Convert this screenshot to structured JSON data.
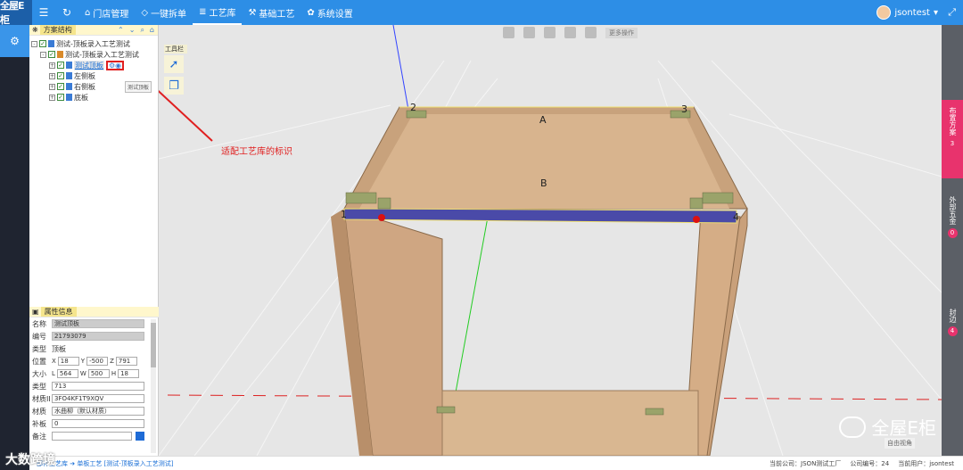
{
  "app": {
    "logo_text": "全屋E柜"
  },
  "topbar": {
    "menu_icon": "menu-icon",
    "refresh_icon": "refresh-icon",
    "nav": [
      {
        "label": "门店管理",
        "icon": "home-icon"
      },
      {
        "label": "一键拆单",
        "icon": "shield-icon"
      },
      {
        "label": "工艺库",
        "icon": "library-icon",
        "active": true
      },
      {
        "label": "基础工艺",
        "icon": "hammer-icon"
      },
      {
        "label": "系统设置",
        "icon": "gear-icon"
      }
    ],
    "username": "jsontest",
    "accent": "#2d8ee6"
  },
  "panel": {
    "header": "方案结构",
    "tree": [
      {
        "level": 0,
        "label": "测试-顶板录入工艺测试"
      },
      {
        "level": 1,
        "label": "测试-顶板录入工艺测试"
      },
      {
        "level": 2,
        "label": "测试顶板",
        "selected": true
      },
      {
        "level": 2,
        "label": "左侧板"
      },
      {
        "level": 2,
        "label": "右侧板"
      },
      {
        "level": 2,
        "label": "底板"
      }
    ],
    "tooltip": "测试顶板",
    "attr_header": "属性信息",
    "attrs": {
      "name_label": "名称",
      "name": "测试顶板",
      "code_label": "编号",
      "code": "21793079",
      "type_label": "类型",
      "type": "顶板",
      "pos_label": "位置",
      "x": "18",
      "y": "-500",
      "z": "791",
      "size_label": "大小",
      "l": "564",
      "w": "500",
      "h": "18",
      "kind_label": "类型",
      "kind": "713",
      "matid_label": "材质II",
      "matid": "3FO4KF1T9XQV",
      "mat_label": "材质",
      "mat": "水曲柳（默认材质）",
      "patch_label": "补板",
      "patch": "0",
      "note_label": "备注",
      "note": ""
    }
  },
  "viewport": {
    "toolbox_label": "工具栏",
    "more_ops": "更多操作",
    "annotation": "适配工艺库的标识",
    "corners": [
      "1",
      "2",
      "3",
      "4"
    ],
    "faces": [
      "A",
      "B"
    ],
    "view_mode": "自由视角",
    "watermark": "全屋E柜"
  },
  "right_rail": [
    {
      "label": "布置方案",
      "count": "3",
      "active": true
    },
    {
      "label": "外部五金",
      "count": "0"
    },
    {
      "label": "封边",
      "count": "4"
    }
  ],
  "statusbar": {
    "crumb": "部件工艺库 ➔ 单板工艺 [测试-顶板录入工艺测试]",
    "company": "当前公司：JSON测试工厂",
    "company_no": "公司编号：24",
    "user": "当前用户：jsontest",
    "footmark": "大数跨境"
  }
}
